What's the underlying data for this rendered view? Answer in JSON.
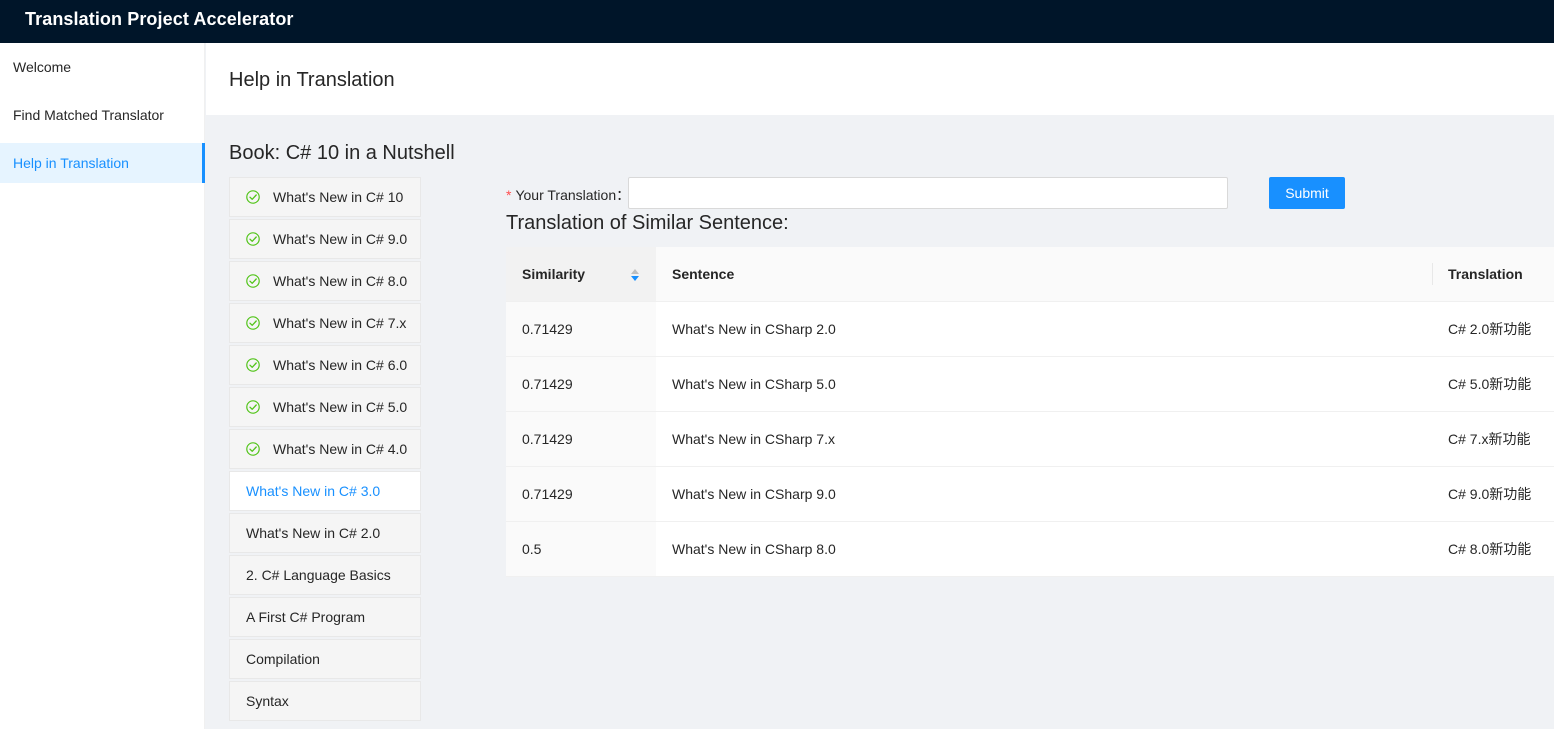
{
  "app": {
    "title": "Translation Project Accelerator"
  },
  "sidebar": {
    "items": [
      {
        "label": "Welcome"
      },
      {
        "label": "Find Matched Translator"
      },
      {
        "label": "Help in Translation"
      }
    ],
    "active_index": 2
  },
  "header": {
    "title": "Help in Translation"
  },
  "book": {
    "title": "Book: C# 10 in a Nutshell",
    "chapters": [
      {
        "label": "What's New in C# 10",
        "done": true
      },
      {
        "label": "What's New in C# 9.0",
        "done": true
      },
      {
        "label": "What's New in C# 8.0",
        "done": true
      },
      {
        "label": "What's New in C# 7.x",
        "done": true
      },
      {
        "label": "What's New in C# 6.0",
        "done": true
      },
      {
        "label": "What's New in C# 5.0",
        "done": true
      },
      {
        "label": "What's New in C# 4.0",
        "done": true
      },
      {
        "label": "What's New in C# 3.0",
        "done": false,
        "active": true
      },
      {
        "label": "What's New in C# 2.0",
        "done": false
      },
      {
        "label": "2. C# Language Basics",
        "done": false
      },
      {
        "label": "A First C# Program",
        "done": false
      },
      {
        "label": "Compilation",
        "done": false
      },
      {
        "label": "Syntax",
        "done": false
      }
    ]
  },
  "form": {
    "required_mark": "*",
    "label": "Your Translation：",
    "input_value": "",
    "submit_label": "Submit"
  },
  "similar": {
    "title": "Translation of Similar Sentence:",
    "columns": [
      "Similarity",
      "Sentence",
      "Translation"
    ],
    "rows": [
      {
        "similarity": "0.71429",
        "sentence": "What's New in CSharp 2.0",
        "translation": "C# 2.0新功能"
      },
      {
        "similarity": "0.71429",
        "sentence": "What's New in CSharp 5.0",
        "translation": "C# 5.0新功能"
      },
      {
        "similarity": "0.71429",
        "sentence": "What's New in CSharp 7.x",
        "translation": "C# 7.x新功能"
      },
      {
        "similarity": "0.71429",
        "sentence": "What's New in CSharp 9.0",
        "translation": "C# 9.0新功能"
      },
      {
        "similarity": "0.5",
        "sentence": "What's New in CSharp 8.0",
        "translation": "C# 8.0新功能"
      }
    ]
  },
  "colors": {
    "topbar": "#001529",
    "accent": "#1890ff",
    "done_icon": "#52c41a",
    "required": "#ff4d4f"
  }
}
